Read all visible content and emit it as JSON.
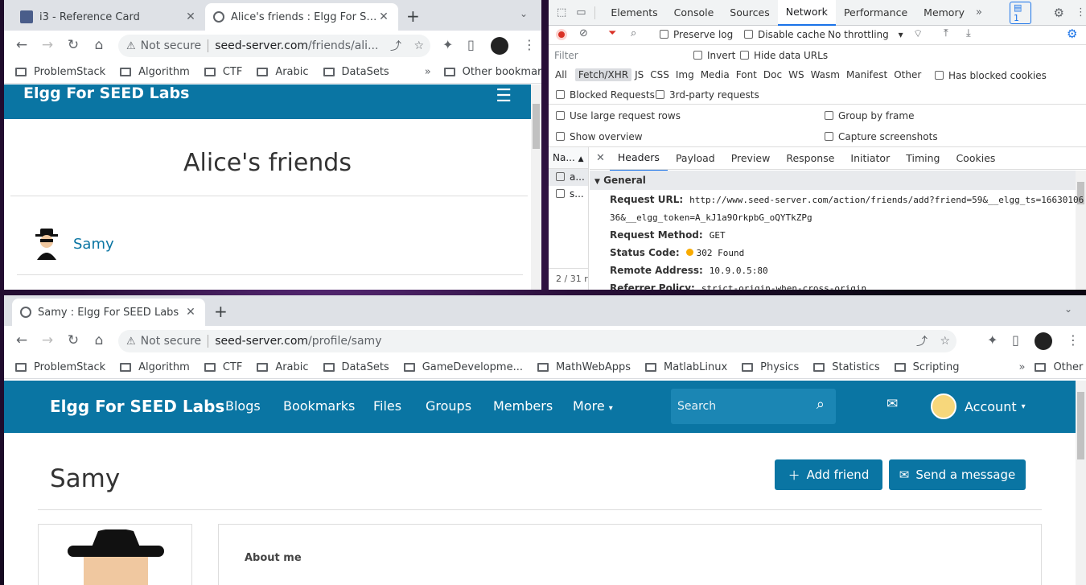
{
  "win1": {
    "tabs": [
      {
        "title": "i3 - Reference Card"
      },
      {
        "title": "Alice's friends : Elgg For SEED"
      }
    ],
    "omnibox": {
      "security": "Not secure",
      "host": "seed-server.com",
      "path": "/friends/ali..."
    },
    "bookmarks": [
      "ProblemStack",
      "Algorithm",
      "CTF",
      "Arabic",
      "DataSets"
    ],
    "other_bookmarks": "Other bookmarks",
    "site_title": "Elgg For SEED Labs",
    "page_heading": "Alice's friends",
    "friend_name": "Samy"
  },
  "devtools": {
    "panels": [
      "Elements",
      "Console",
      "Sources",
      "Network",
      "Performance",
      "Memory"
    ],
    "active_panel": "Network",
    "issues_count": "1",
    "preserve_log": "Preserve log",
    "disable_cache": "Disable cache",
    "throttling": "No throttling",
    "filter_placeholder": "Filter",
    "invert": "Invert",
    "hide_data_urls": "Hide data URLs",
    "type_filters": [
      "All",
      "Fetch/XHR",
      "JS",
      "CSS",
      "Img",
      "Media",
      "Font",
      "Doc",
      "WS",
      "Wasm",
      "Manifest",
      "Other"
    ],
    "active_type": "Fetch/XHR",
    "has_blocked_cookies": "Has blocked cookies",
    "blocked_requests": "Blocked Requests",
    "third_party": "3rd-party requests",
    "large_rows": "Use large request rows",
    "group_by_frame": "Group by frame",
    "show_overview": "Show overview",
    "capture_screenshots": "Capture screenshots",
    "name_col": "Na...",
    "requests": [
      "a...",
      "s..."
    ],
    "summary": "2 / 31 r",
    "detail_tabs": [
      "Headers",
      "Payload",
      "Preview",
      "Response",
      "Initiator",
      "Timing",
      "Cookies"
    ],
    "active_detail": "Headers",
    "section": "General",
    "headers": {
      "url_label": "Request URL:",
      "url_line1": "http://www.seed-server.com/action/friends/add?friend=59&__elgg_ts=16630106",
      "url_line2": "36&__elgg_token=A_kJ1a9OrkpbG_oQYTkZPg",
      "method_label": "Request Method:",
      "method": "GET",
      "status_label": "Status Code:",
      "status": "302 Found",
      "remote_label": "Remote Address:",
      "remote": "10.9.0.5:80",
      "referrer_label": "Referrer Policy:",
      "referrer": "strict-origin-when-cross-origin"
    }
  },
  "win2": {
    "tab_title": "Samy : Elgg For SEED Labs",
    "omnibox": {
      "security": "Not secure",
      "host": "seed-server.com",
      "path": "/profile/samy"
    },
    "bookmarks": [
      "ProblemStack",
      "Algorithm",
      "CTF",
      "Arabic",
      "DataSets",
      "GameDevelopme...",
      "MathWebApps",
      "MatlabLinux",
      "Physics",
      "Statistics",
      "Scripting"
    ],
    "other_bookmarks": "Other bookmarks",
    "site_title": "Elgg For SEED Labs",
    "nav": [
      "Blogs",
      "Bookmarks",
      "Files",
      "Groups",
      "Members",
      "More"
    ],
    "search_placeholder": "Search",
    "account": "Account",
    "profile_name": "Samy",
    "add_friend": "Add friend",
    "send_message": "Send a message",
    "about_heading": "About me"
  }
}
